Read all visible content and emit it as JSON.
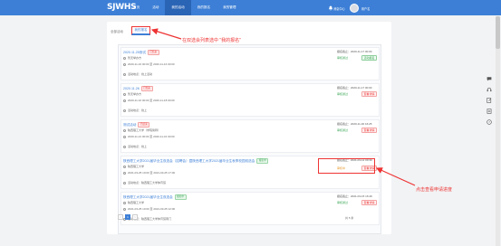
{
  "header": {
    "logo": "SJWHS",
    "nav": [
      {
        "label": "首页"
      },
      {
        "label": "活动"
      },
      {
        "label": "我的活动"
      },
      {
        "label": "我的报名"
      },
      {
        "label": "我的管理"
      }
    ],
    "notice": "消息中心",
    "user": "用户名"
  },
  "tabs": [
    {
      "label": "全部活动"
    },
    {
      "label": "我的报名"
    }
  ],
  "items": [
    {
      "title": "2020.11.25测试",
      "badge": "已结束",
      "badge_color": "red",
      "meta1": "暂无举办方",
      "meta2": "2020-11-16 00:00 至 2020-11-16 00:00",
      "meta3": "活动地点：线上活动",
      "deadline": "报名截止：2020-11-17 00:00",
      "status": "审核通过",
      "status_color": "green",
      "button": "活动报名",
      "button_color": "green"
    },
    {
      "title": "2020.11.26",
      "badge": "已结束",
      "badge_color": "red",
      "meta1": "暂无举办方",
      "meta2": "2020-11-16 00:00 至 2020-11-18 00:00",
      "meta3": "活动地点：线上",
      "deadline": "报名截止：2020-11-17 00:00",
      "status": "审核通过",
      "status_color": "green",
      "button": "查看详情",
      "button_color": "red"
    },
    {
      "title": "测试活动",
      "badge": "已结束",
      "badge_color": "red",
      "meta1": "陕西理工大学（学院简称）",
      "meta2": "2020-11-21 00:00 至 2020-11-31 00:00",
      "meta3": "活动地点：线上",
      "deadline": "报名截止：2020-11-30 16:25",
      "status": "审核通过",
      "status_color": "green",
      "button": "查看详情",
      "button_color": "red"
    },
    {
      "title": "陕西理工大学2021届毕业生双选会（招聘会）暨陕西理工大学2021届毕业生秋季校园双选会",
      "badge": "报名中",
      "badge_color": "green",
      "meta1": "陕西理工大学",
      "meta2": "2021-03-25 10:00 至 2021-03-25 17:00",
      "meta3": "活动地点：陕西理工大学体育馆",
      "deadline": "报名截止：2021-03-12 09:39",
      "status": "审核中",
      "status_color": "orange",
      "button": "查看详情",
      "button_color": "red"
    },
    {
      "title": "陕西理工大学2021届毕业生双选会",
      "badge": "报名中",
      "badge_color": "green",
      "meta1": "陕西理工大学",
      "meta2": "2021-03-25 10:00 至 2021-03-25 12:00",
      "meta3": "活动地点：陕西理工大学体育馆南门",
      "deadline": "报名截止：2021-03-15 16:49",
      "status": "审核通过",
      "status_color": "green",
      "button": "查看详情",
      "button_color": "red"
    }
  ],
  "pager": {
    "pages": [
      "<",
      "1",
      ">"
    ],
    "active_index": 1,
    "total": "共 5 条"
  },
  "annotations": {
    "a1": "在双选会列表选中 \"我的报名\"",
    "a2": "点击查看申请进度"
  },
  "sidebar_icons": [
    "chat-icon",
    "headset-icon",
    "edit-icon",
    "doc-icon",
    "help-icon"
  ]
}
